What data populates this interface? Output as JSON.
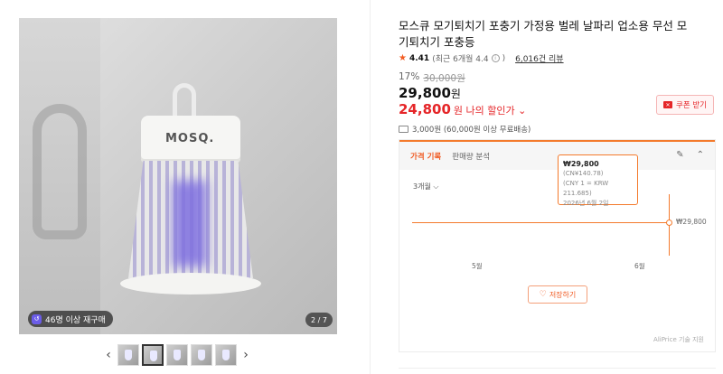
{
  "gallery": {
    "brand_on_product": "MOSQ.",
    "repurchase_badge": "46명 이상 재구매",
    "counter": "2 / 7",
    "prev_icon": "chevron-left-icon",
    "next_icon": "chevron-right-icon",
    "thumbnail_count": 5,
    "active_thumbnail": 2
  },
  "product": {
    "title": "모스큐 모기퇴치기 포충기 가정용 벌레 날파리 업소용 무선 모기퇴치기 포충등",
    "rating": "4.41",
    "rating_detail": "(최근 6개월 4.4",
    "rating_close": ")",
    "review_count": "6,016건 리뷰",
    "discount_percent": "17%",
    "original_price": "30,000원",
    "price": "29,800",
    "price_unit": "원",
    "my_price": "24,800",
    "my_price_label": "원 나의 할인가 ⌄",
    "coupon_label": "쿠폰 받기",
    "shipping": "3,000원 (60,000원 이상 무료배송)"
  },
  "tracker": {
    "tab_history": "가격 기록",
    "tab_sales": "판매량 분석",
    "period": "3개월 ⌵",
    "tooltip": {
      "price": "₩29,800",
      "cny": "(CN¥140.78)",
      "rate": "(CNY 1 = KRW 211.685)",
      "date": "2026년 6월 2일"
    },
    "point_label": "₩29,800",
    "save_label": "저장하기",
    "credit": "AliPrice 기술 지원",
    "accent_color": "#f47a2c"
  },
  "chart_data": {
    "type": "line",
    "x": [
      "5월",
      "6월"
    ],
    "series": [
      {
        "values": [
          29800,
          29800
        ]
      }
    ],
    "current_date": "2026년 6월 2일",
    "current_value": 29800
  }
}
